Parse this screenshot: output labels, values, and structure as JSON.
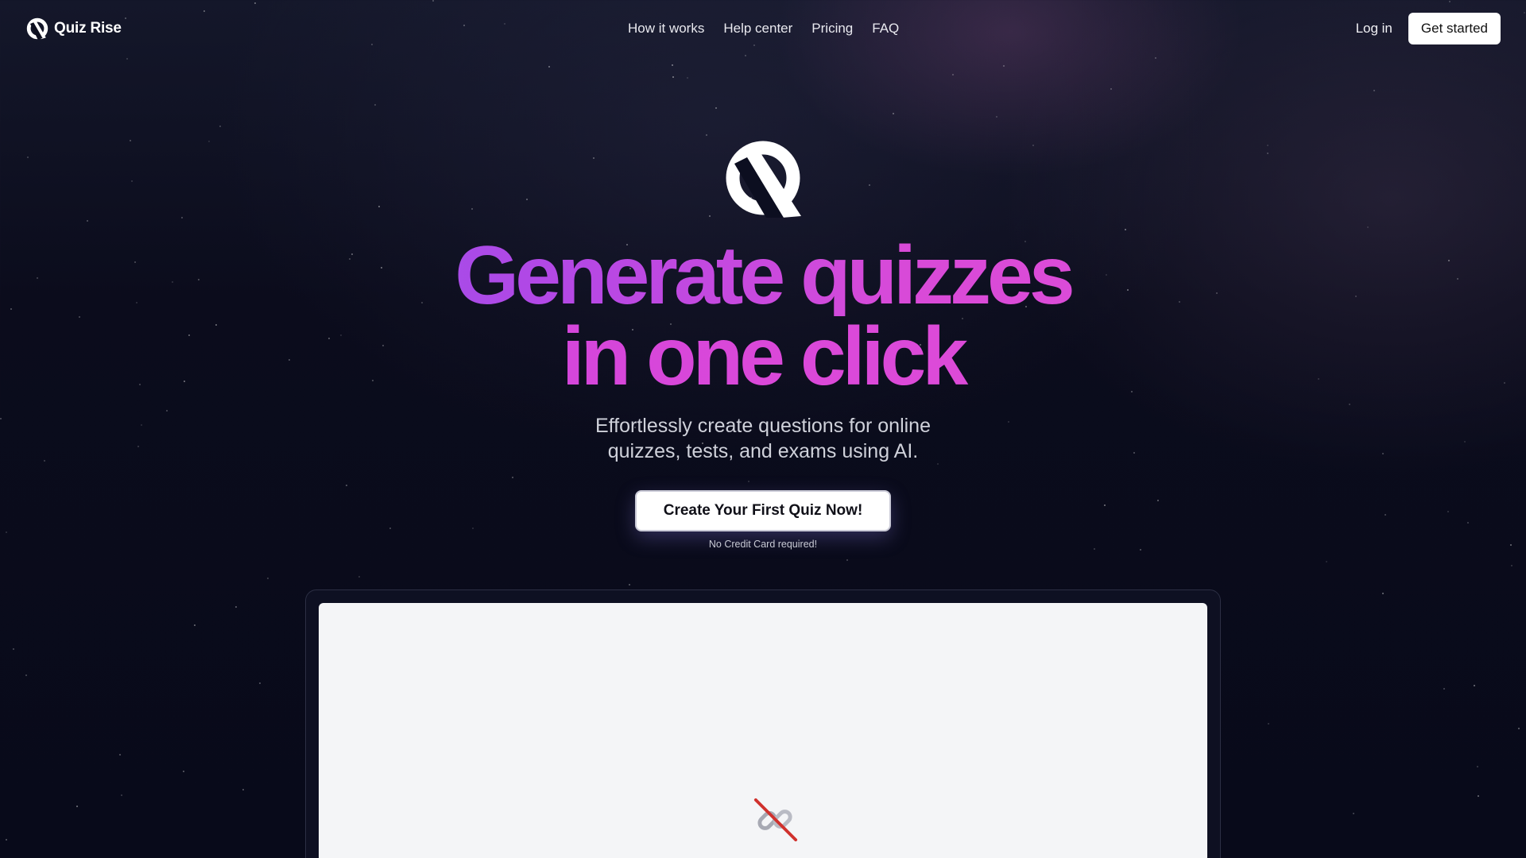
{
  "brand": {
    "name": "Quiz Rise",
    "icon": "quiz-rise-logo-icon"
  },
  "nav": {
    "items": [
      "How it works",
      "Help center",
      "Pricing",
      "FAQ"
    ]
  },
  "header_actions": {
    "login": "Log in",
    "get_started": "Get started"
  },
  "hero": {
    "logo_icon": "quiz-rise-logo-icon",
    "headline_line1": "Generate quizzes",
    "headline_line2": "in one click",
    "subtitle_line1": "Effortlessly create questions for online",
    "subtitle_line2": "quizzes, tests, and exams using AI.",
    "cta_label": "Create Your First Quiz Now!",
    "cta_note": "No Credit Card required!"
  },
  "preview": {
    "icon": "broken-link-icon"
  },
  "colors": {
    "background": "#0b0c1c",
    "headline_gradient_start": "#7b5cf0",
    "headline_gradient_end": "#e14fd6",
    "preview_panel": "#f4f5f7",
    "broken_link_slash": "#d0312d"
  }
}
